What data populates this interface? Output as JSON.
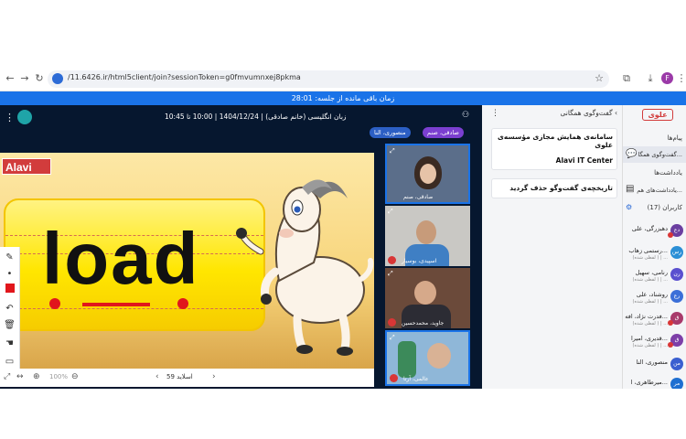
{
  "browser": {
    "url": "/11.6426.ir/html5client/join?sessionToken=g0fmvumnxej8pkma",
    "avatar": "F"
  },
  "banner": {
    "text": "زمان باقی مانده از جلسه: 28:01"
  },
  "session": {
    "title": "زبان انگلیسی (خانم صادقی) | 1404/12/24 | 10:00 تا 10:45",
    "presenters": [
      "صادقی، صنم",
      "منصوری، النا"
    ]
  },
  "slide": {
    "logo": "Alavi",
    "word": "load",
    "slide_label": "اسلاید 59",
    "zoom": "100%"
  },
  "videos": [
    {
      "name": "صادقی، صنم"
    },
    {
      "name": "اسپیدی، بوسیار"
    },
    {
      "name": "جاوید، محمدحسین"
    },
    {
      "name": "عالمی، آرتا"
    }
  ],
  "chat": {
    "header": "گفت‌وگوی همگانی",
    "messages": [
      {
        "line1": "سامانه‌ی همایش مجازی مؤسسه‌ی علوی",
        "line2": "Alavi IT Center"
      },
      {
        "line1": "تاریخچه‌ی گفت‌وگو حذف گردید"
      }
    ]
  },
  "sidebar": {
    "logo": "علوی",
    "messages_label": "پیام‌ها",
    "public_chat": "گفت‌وگوی همگا...",
    "notes_label": "یادداشت‌ها",
    "shared_notes": "یادداشت‌های هم...",
    "users_label": "کاربران (17)",
    "users": [
      {
        "name": "دهبزرگی، علی",
        "status": "",
        "initials": "دع",
        "color": "#6b3fa0"
      },
      {
        "name": "رستمی زهاب...",
        "status": "(لفظی شده ) | ...",
        "initials": "رس",
        "color": "#2b8fd6"
      },
      {
        "name": "رنامی، سهیل",
        "status": "(لفظی شده ) | ...",
        "initials": "رن",
        "color": "#5a4fcf"
      },
      {
        "name": "روشناد، علی",
        "status": "(لفظی شده ) | ...",
        "initials": "رع",
        "color": "#3b6fd8"
      },
      {
        "name": "فدرت نژاد، افه...",
        "status": "(لفظی شده ) | ...",
        "initials": "ق",
        "color": "#a83a6b"
      },
      {
        "name": "قدیری، امیرا...",
        "status": "(لفظی شده ) | ...",
        "initials": "ق",
        "color": "#7d3fa8"
      },
      {
        "name": "منصوری، النا",
        "status": "",
        "initials": "من",
        "color": "#3a5fd0"
      },
      {
        "name": "میرطاهری، ا...",
        "status": "",
        "initials": "مر",
        "color": "#1f6fd1"
      }
    ]
  },
  "colors": {
    "banner": "#1a73e8",
    "stage": "#06172f",
    "pill_purple": "#7b3fd0"
  }
}
